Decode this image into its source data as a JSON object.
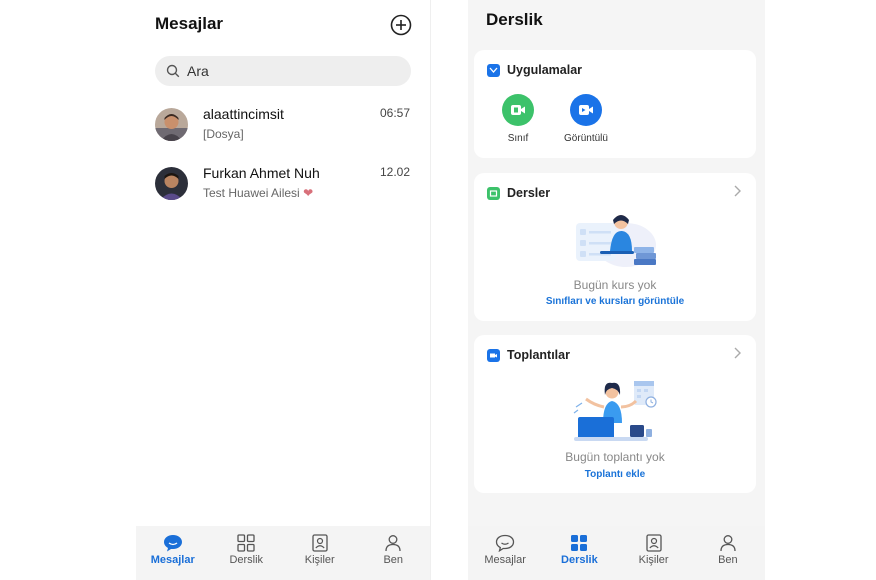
{
  "messages_screen": {
    "title": "Mesajlar",
    "search_placeholder": "Ara",
    "chats": [
      {
        "name": "alaattincimsit",
        "preview": "[Dosya]",
        "time": "06:57"
      },
      {
        "name": "Furkan Ahmet Nuh",
        "preview": "Test Huawei Ailesi",
        "time": "12.02"
      }
    ],
    "nav": [
      {
        "label": "Mesajlar",
        "icon": "chat-bubble-icon",
        "active": true
      },
      {
        "label": "Derslik",
        "icon": "grid-icon",
        "active": false
      },
      {
        "label": "Kişiler",
        "icon": "contacts-icon",
        "active": false
      },
      {
        "label": "Ben",
        "icon": "person-icon",
        "active": false
      }
    ]
  },
  "classroom_screen": {
    "title": "Derslik",
    "apps_card": {
      "title": "Uygulamalar",
      "apps": [
        {
          "label": "Sınıf",
          "icon": "class-video-icon",
          "color": "#3cc26a"
        },
        {
          "label": "Görüntülü",
          "icon": "video-call-icon",
          "color": "#1a73e8"
        }
      ]
    },
    "courses_card": {
      "title": "Dersler",
      "empty_text": "Bugün kurs yok",
      "link": "Sınıfları ve kursları görüntüle"
    },
    "meetings_card": {
      "title": "Toplantılar",
      "empty_text": "Bugün toplantı yok",
      "link": "Toplantı ekle"
    },
    "nav": [
      {
        "label": "Mesajlar",
        "icon": "chat-bubble-icon",
        "active": false
      },
      {
        "label": "Derslik",
        "icon": "grid-icon",
        "active": true
      },
      {
        "label": "Kişiler",
        "icon": "contacts-icon",
        "active": false
      },
      {
        "label": "Ben",
        "icon": "person-icon",
        "active": false
      }
    ]
  },
  "colors": {
    "accent": "#1a6fd8",
    "green": "#3cc26a",
    "blue": "#1a73e8"
  }
}
